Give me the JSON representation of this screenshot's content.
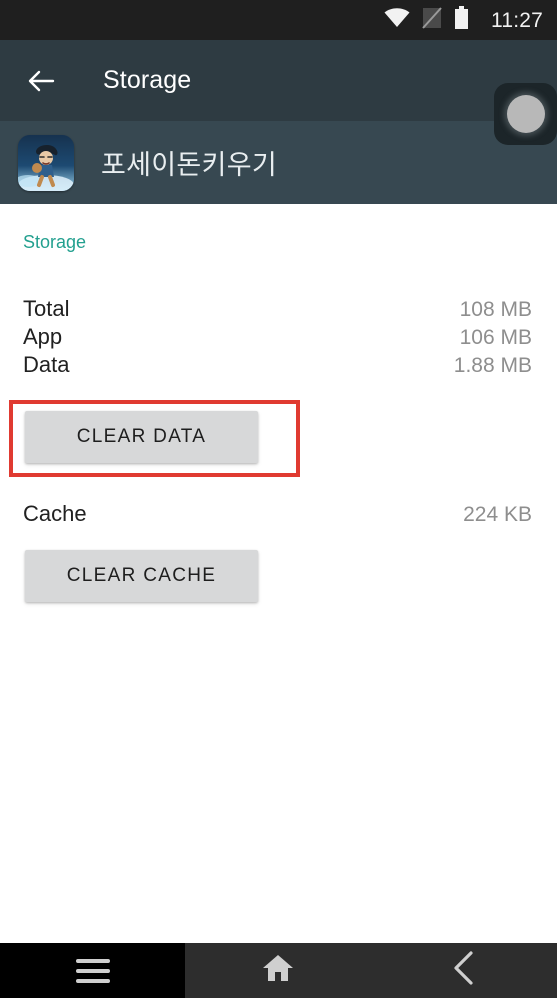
{
  "status_bar": {
    "time": "11:27",
    "icons": [
      {
        "name": "wifi-icon",
        "label": "wifi"
      },
      {
        "name": "signal-off-icon",
        "label": "no-sim"
      },
      {
        "name": "battery-icon",
        "label": "battery-full"
      }
    ]
  },
  "app_bar": {
    "back_label": "back",
    "title": "Storage"
  },
  "app_header": {
    "app_name": "포세이돈키우기",
    "icon_name": "app-icon-poseidon"
  },
  "overlay": {
    "name": "floating-record-button"
  },
  "content": {
    "section_title": "Storage",
    "rows": [
      {
        "label": "Total",
        "value": "108 MB"
      },
      {
        "label": "App",
        "value": "106 MB"
      },
      {
        "label": "Data",
        "value": "1.88 MB"
      }
    ],
    "clear_data_label": "CLEAR DATA",
    "cache": {
      "label": "Cache",
      "value": "224 KB"
    },
    "clear_cache_label": "CLEAR CACHE"
  },
  "annotation": {
    "color": "#e03a31",
    "target": "clear-data-button"
  },
  "nav_bar": {
    "recents_label": "recents",
    "home_label": "home",
    "back_label": "back"
  },
  "colors": {
    "app_bar_bg": "#2e3b42",
    "app_header_bg": "#374851",
    "section_accent": "#23a08f",
    "value_text": "#8e8e8e",
    "button_bg": "#d7d8d9",
    "nav_bg": "#2d2d2d",
    "status_bg": "#1f1f1f"
  }
}
